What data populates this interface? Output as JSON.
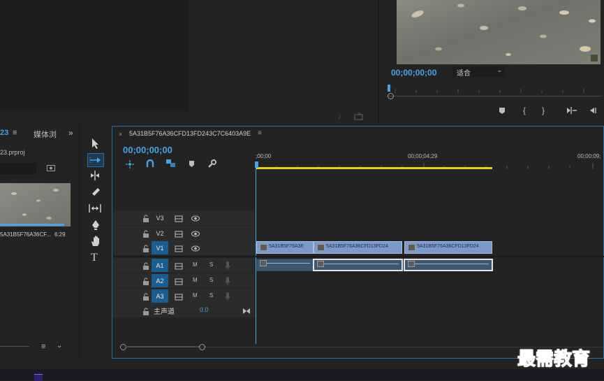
{
  "program_monitor": {
    "timecode": "00;00;00;00",
    "fit_option": "适合"
  },
  "project_panel": {
    "tab_fragment": "23",
    "media_tab": "媒体浏",
    "file_name": "23.prproj",
    "clip_name": "5A31B5F76A36CF...",
    "clip_duration": "6:29"
  },
  "timeline": {
    "sequence_name": "5A31B5F76A36CFD13FD243C7C6403A9E",
    "timecode": "00;00;00;00",
    "ruler": {
      "t0": ";00;00",
      "t1": "00;00;04;29",
      "t2": "00;00;09;"
    },
    "tracks": {
      "v3": "V3",
      "v2": "V2",
      "v1": "V1",
      "a1": "A1",
      "a2": "A2",
      "a3": "A3",
      "m": "M",
      "s": "S",
      "master": "主声道",
      "master_value": "0.0"
    },
    "clips": {
      "c1": "5A31B5F76A36",
      "c2": "5A31B5F76A36CFD13FD24",
      "c3": "5A31B5F76A36CFD13FD24"
    }
  },
  "watermark": "最需教育",
  "colors": {
    "accent_blue": "#4aa3df",
    "work_area_yellow": "#e6d21a",
    "video_clip": "#7b99c9",
    "audio_clip": "#3f5670"
  }
}
